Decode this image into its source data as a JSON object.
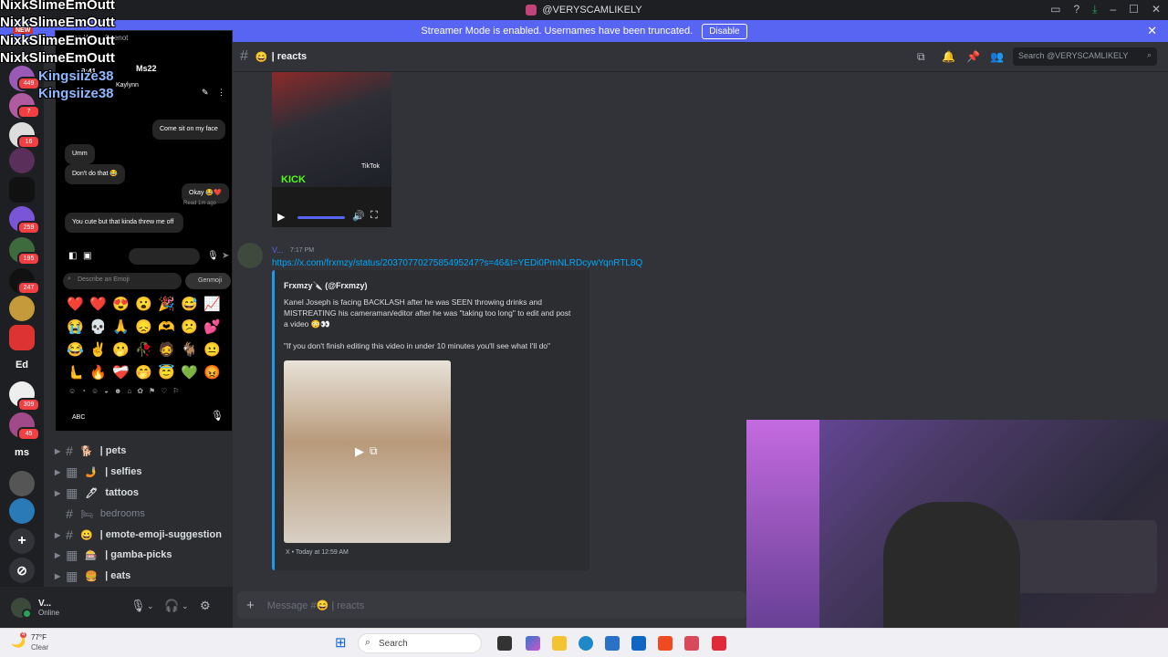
{
  "window": {
    "title": "@VERYSCAMLIKELY"
  },
  "banner": {
    "text": "Streamer Mode is enabled. Usernames have been truncated.",
    "button": "Disable"
  },
  "servers": {
    "badges": [
      "449",
      "7",
      "16",
      "259",
      "195",
      "247",
      "309",
      "45"
    ],
    "letter_icons": [
      "Ed",
      "ms"
    ]
  },
  "channels": [
    {
      "name": "| pets",
      "emoji": "🐕"
    },
    {
      "name": "| selfies",
      "emoji": "🤳"
    },
    {
      "name": "tattoos",
      "emoji": "🖊"
    },
    {
      "name": "bedrooms",
      "emoji": "🛏"
    },
    {
      "name": "| emote-emoji-suggestion",
      "emoji": "😀"
    },
    {
      "name": "| gamba-picks",
      "emoji": "🎰"
    },
    {
      "name": "| eats",
      "emoji": "🍔"
    }
  ],
  "user_panel": {
    "name": "V...",
    "status": "Online"
  },
  "overlay": {
    "chatters": [
      "NixkSlimeEmOutt",
      "NixkSlimeEmOutt",
      "NixkSlimeEmOutt",
      "NixkSlimeEmOutt",
      "Kingsiize38",
      "Kingsiize38"
    ],
    "small": [
      "NEW"
    ]
  },
  "phone": {
    "time": "8:41",
    "contact": "Kaylynn",
    "handle": "Ms22",
    "messages": [
      {
        "side": "right",
        "text": "Come sit on my face"
      },
      {
        "side": "left",
        "text": "Umm"
      },
      {
        "side": "left",
        "text": "Don't do that 😂"
      },
      {
        "side": "right",
        "text": "Okay 😂❤️"
      },
      {
        "side": "left",
        "text": "You cute but that kinda threw me off"
      }
    ],
    "read_receipt": "Read 1m ago",
    "emoji_search_placeholder": "Describe an Emoji",
    "genmoji": "Genmoji",
    "emoji_rows": [
      [
        "❤️",
        "❤️",
        "😍",
        "😮",
        "🎉",
        "😅",
        "📈"
      ],
      [
        "😭",
        "💀",
        "🙏",
        "😞",
        "🫶",
        "😕",
        "💕"
      ],
      [
        "😂",
        "✌️",
        "🫢",
        "🥀",
        "🧔",
        "🐐",
        "😐"
      ],
      [
        "🫷",
        "🔥",
        "❤️‍🩹",
        "🤭",
        "😇",
        "💚",
        "😡"
      ]
    ],
    "keyboard_label": "ABC",
    "mini_label": "Dan Wm... Seenot"
  },
  "chat": {
    "channel": "| reacts",
    "channel_emoji": "😄",
    "search_placeholder": "Search @VERYSCAMLIKELY",
    "message": {
      "author": "V...",
      "time": "7:17 PM",
      "link": "https://x.com/frxmzy/status/2037077027585495247?s=46&t=YEDi0PmNLRDcywYqnRTL8Q"
    },
    "embed": {
      "author": "Frxmzy🔪 (@Frxmzy)",
      "body": "Kanel Joseph is facing BACKLASH after he was SEEN throwing drinks and MISTREATING his cameraman/editor after he was \"taking too long\" to edit and post a video 😳👀",
      "quote": "\"If you don't finish editing this video in under 10 minutes you'll see what I'll do\"",
      "footer": "X • Today at 12:59 AM"
    },
    "video_overlay": "KICK",
    "tiktok": "TikTok",
    "input_placeholder_prefix": "Message #😄",
    "input_placeholder_channel": "| reacts"
  },
  "taskbar": {
    "weather_temp": "77°F",
    "weather_desc": "Clear",
    "search": "Search",
    "notif": "4"
  }
}
